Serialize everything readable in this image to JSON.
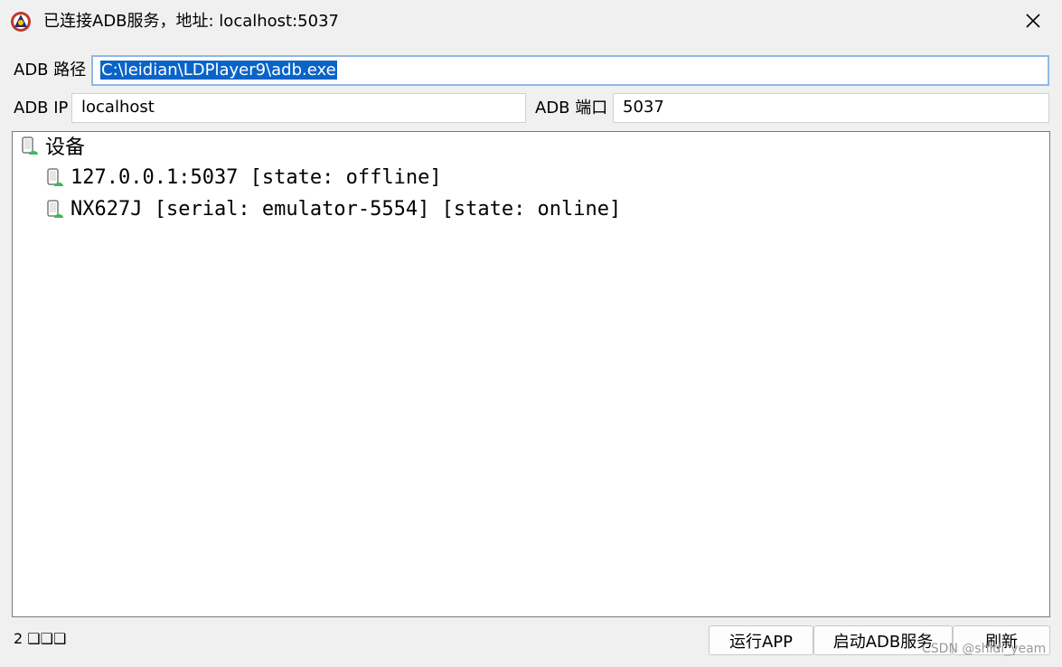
{
  "window": {
    "title": "已连接ADB服务，地址: localhost:5037"
  },
  "form": {
    "adb_path_label": "ADB 路径",
    "adb_path_value": "C:\\leidian\\LDPlayer9\\adb.exe",
    "adb_ip_label": "ADB IP",
    "adb_ip_value": "localhost",
    "adb_port_label": "ADB 端口",
    "adb_port_value": "5037"
  },
  "tree": {
    "root_label": "设备",
    "items": [
      {
        "label": "127.0.0.1:5037 [state: offline]"
      },
      {
        "label": "NX627J [serial: emulator-5554] [state: online]"
      }
    ]
  },
  "status": {
    "text": "2 ❑❑❑"
  },
  "buttons": {
    "run_app": "运行APP",
    "start_adb": "启动ADB服务",
    "refresh": "刷新"
  },
  "watermark": "CSDN @shidi_yeam",
  "colors": {
    "selection": "#0a64c8",
    "focus_border": "#8fb8e6",
    "device_icon_accent": "#3cba54"
  }
}
